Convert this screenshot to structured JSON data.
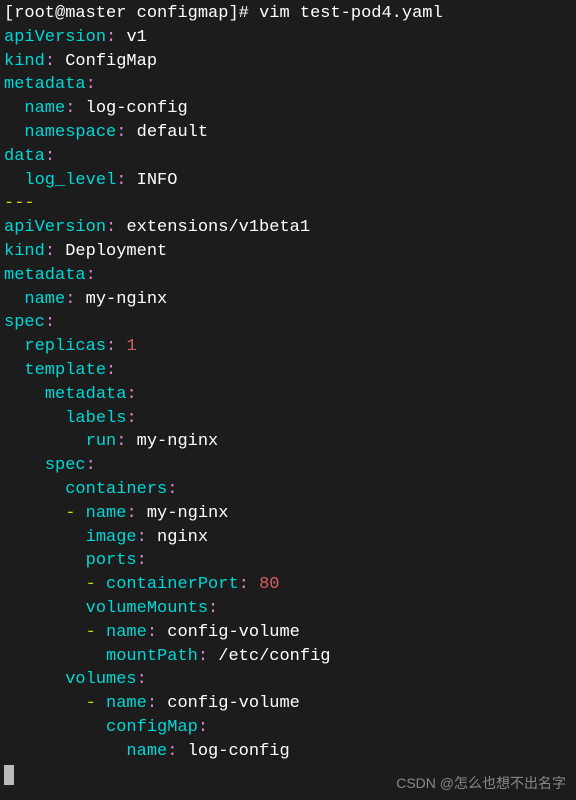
{
  "prompt": {
    "user_host": "root@master",
    "path": "configmap",
    "command": "vim test-pod4.yaml"
  },
  "doc1": {
    "apiVersion_key": "apiVersion",
    "apiVersion_val": "v1",
    "kind_key": "kind",
    "kind_val": "ConfigMap",
    "metadata_key": "metadata",
    "name_key": "name",
    "name_val": "log-config",
    "namespace_key": "namespace",
    "namespace_val": "default",
    "data_key": "data",
    "log_level_key": "log_level",
    "log_level_val": "INFO"
  },
  "separator": "---",
  "doc2": {
    "apiVersion_key": "apiVersion",
    "apiVersion_val": "extensions/v1beta1",
    "kind_key": "kind",
    "kind_val": "Deployment",
    "metadata_key": "metadata",
    "name_key": "name",
    "name_val": "my-nginx",
    "spec_key": "spec",
    "replicas_key": "replicas",
    "replicas_val": "1",
    "template_key": "template",
    "template_metadata_key": "metadata",
    "labels_key": "labels",
    "run_key": "run",
    "run_val": "my-nginx",
    "template_spec_key": "spec",
    "containers_key": "containers",
    "container_name_key": "name",
    "container_name_val": "my-nginx",
    "image_key": "image",
    "image_val": "nginx",
    "ports_key": "ports",
    "containerPort_key": "containerPort",
    "containerPort_val": "80",
    "volumeMounts_key": "volumeMounts",
    "vm_name_key": "name",
    "vm_name_val": "config-volume",
    "mountPath_key": "mountPath",
    "mountPath_val": "/etc/config",
    "volumes_key": "volumes",
    "vol_name_key": "name",
    "vol_name_val": "config-volume",
    "configMap_key": "configMap",
    "cm_name_key": "name",
    "cm_name_val": "log-config"
  },
  "watermark": "CSDN @怎么也想不出名字"
}
